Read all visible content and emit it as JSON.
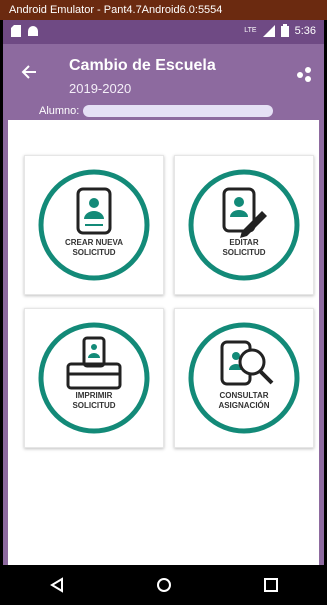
{
  "window": {
    "title": "Android Emulator - Pant4.7Android6.0:5554"
  },
  "status_bar": {
    "time": "5:36",
    "network": "LTE"
  },
  "app_bar": {
    "title": "Cambio de Escuela",
    "subtitle": "2019-2020",
    "student_label": "Alumno:"
  },
  "cards": [
    {
      "line1": "CREAR NUEVA",
      "line2": "SOLICITUD",
      "icon": "id-card-icon"
    },
    {
      "line1": "EDITAR",
      "line2": "SOLICITUD",
      "icon": "id-card-pencil-icon"
    },
    {
      "line1": "IMPRIMIR",
      "line2": "SOLICITUD",
      "icon": "printer-icon"
    },
    {
      "line1": "CONSULTAR",
      "line2": "ASIGNACIÓN",
      "icon": "search-card-icon"
    }
  ],
  "colors": {
    "teal": "#138a78",
    "app_bar": "#8d6a9f",
    "status_bar": "#6f4a84",
    "window_title": "#6b2a10"
  }
}
